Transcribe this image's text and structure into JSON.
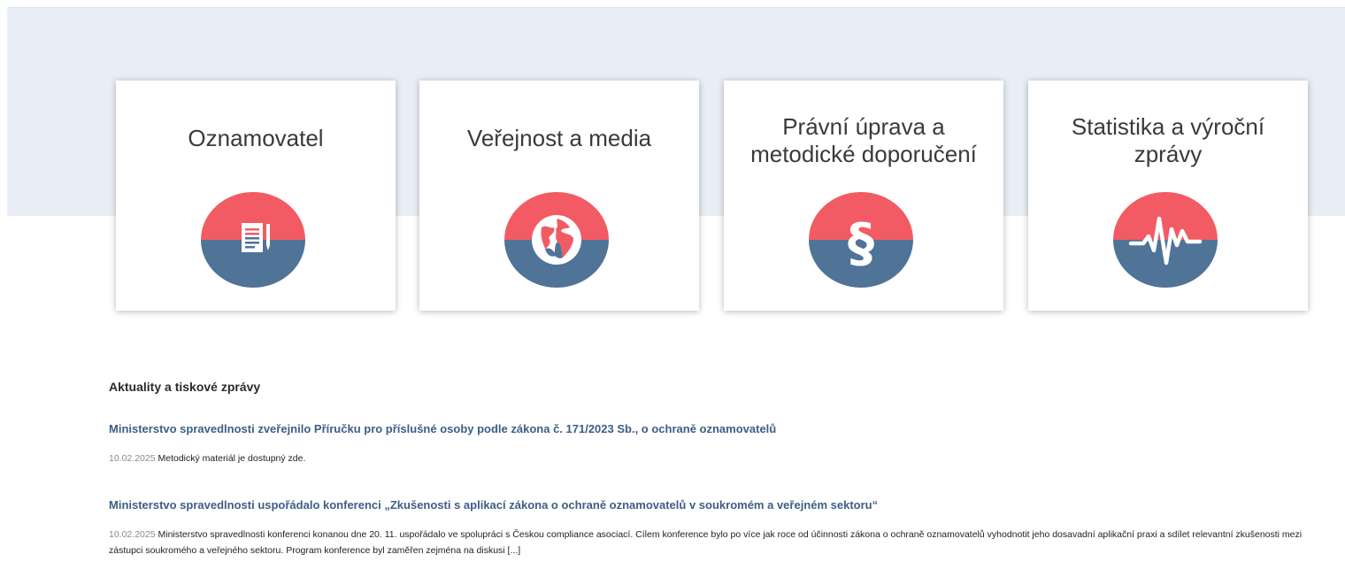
{
  "cards": [
    {
      "title": "Oznamovatel",
      "icon": "document-pen-icon"
    },
    {
      "title": "Veřejnost a media",
      "icon": "globe-icon"
    },
    {
      "title": "Právní úprava a metodické doporučení",
      "icon": "paragraph-icon"
    },
    {
      "title": "Statistika a výroční zprávy",
      "icon": "pulse-icon"
    }
  ],
  "colors": {
    "circle_top": "#f25b64",
    "circle_bottom": "#507398",
    "hero_background": "#e9eef6",
    "link": "#3d5e86"
  },
  "news": {
    "heading": "Aktuality a tiskové zprávy",
    "items": [
      {
        "title": "Ministerstvo spravedlnosti zveřejnilo Příručku pro příslušné osoby podle zákona č. 171/2023 Sb., o ochraně oznamovatelů",
        "date": "10.02.2025",
        "text": "Metodický materiál je dostupný zde."
      },
      {
        "title": "Ministerstvo spravedlnosti uspořádalo konferenci „Zkušenosti s aplikací zákona o ochraně oznamovatelů v soukromém a veřejném sektoru“",
        "date": "10.02.2025",
        "text": "Ministerstvo spravedlnosti konferenci konanou dne 20. 11. uspořádalo ve spolupráci s Českou compliance asociací. Cílem konference bylo po více jak roce od účinnosti zákona o ochraně oznamovatelů vyhodnotit jeho dosavadní aplikační praxi a sdílet relevantní zkušenosti mezi zástupci soukromého a veřejného sektoru. Program konference byl zaměřen zejména na diskusi [...]"
      }
    ]
  }
}
